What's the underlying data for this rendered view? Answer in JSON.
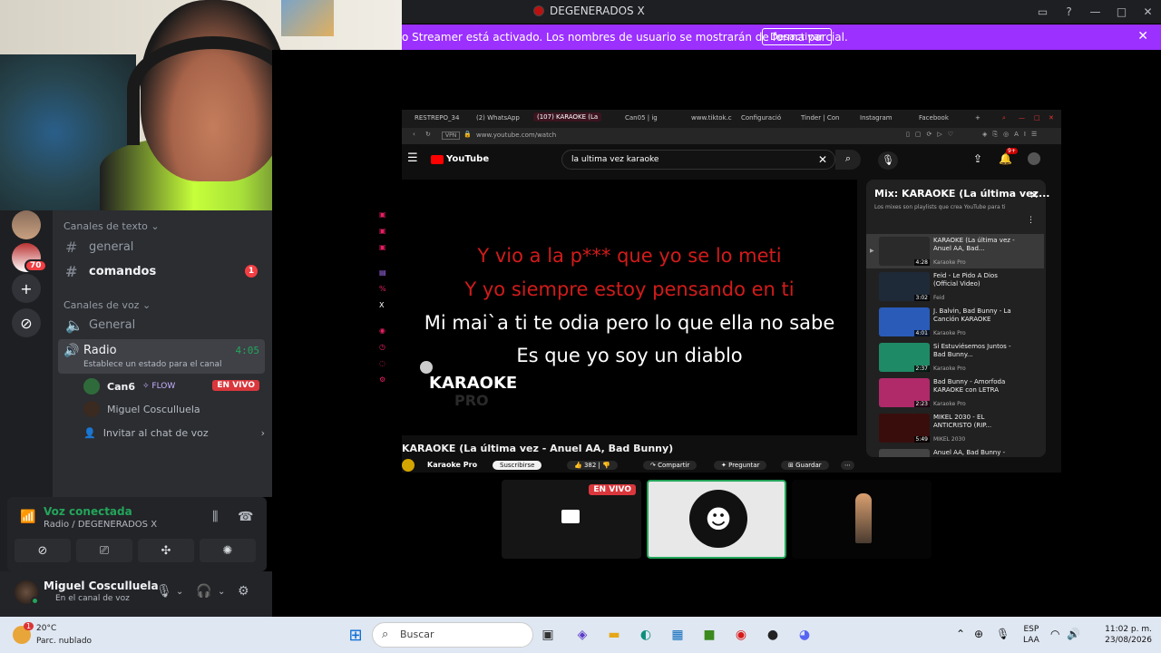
{
  "titlebar": {
    "title": "DEGENERADOS X"
  },
  "banner": {
    "message": "o Streamer está activado. Los nombres de usuario se mostrarán de forma parcial.",
    "button": "Desactivar"
  },
  "servers": {
    "badge": "70"
  },
  "channels": {
    "text_category": "Canales de texto",
    "text_channels": [
      {
        "name": "general"
      },
      {
        "name": "comandos",
        "unread": "1"
      }
    ],
    "voice_category": "Canales de voz",
    "voice_channels": [
      {
        "name": "General"
      }
    ],
    "radio": {
      "name": "Radio",
      "time": "4:05",
      "status": "Establece un estado para el canal"
    },
    "members": [
      {
        "name": "Can6",
        "activity": "FLOW",
        "live": "EN VIVO"
      },
      {
        "name": "Miguel Cosculluela"
      }
    ],
    "invite": "Invitar al chat de voz"
  },
  "voice": {
    "status": "Voz conectada",
    "location": "Radio / DEGENERADOS X"
  },
  "user": {
    "name": "Miguel Cosculluela",
    "status": "En el canal de voz"
  },
  "browser": {
    "tabs": [
      "RESTREPO_34",
      "(2) WhatsApp",
      "(107) KARAOKE (La",
      "Can05 | ig",
      "www.tiktok.c",
      "Configuració",
      "Tinder | Con",
      "Instagram",
      "Facebook"
    ],
    "url": "www.youtube.com/watch",
    "yt_logo": "YouTube",
    "search": "la ultima vez karaoke",
    "lyrics": {
      "line1": "Y vio a la p*** que yo se lo meti",
      "line2": "Y yo siempre estoy pensando en ti",
      "line3": "Mi mai`a ti te odia pero lo que ella no sabe",
      "line4": "Es que yo soy un diablo"
    },
    "watermark": "KARAOKE",
    "watermark2": "PRO",
    "video_title": "KARAOKE (La última vez - Anuel AA, Bad Bunny)",
    "channel": "Karaoke Pro",
    "subscribe": "Suscribirse",
    "likes": "382",
    "share": "Compartir",
    "ask": "Preguntar",
    "save": "Guardar",
    "mix": {
      "title": "Mix: KARAOKE (La última vez...",
      "subtitle": "Los mixes son playlists que crea YouTube para ti",
      "items": [
        {
          "title": "KARAOKE (La última vez - Anuel AA, Bad...",
          "channel": "Karaoke Pro",
          "duration": "4:28"
        },
        {
          "title": "Feid - Le Pido A Dios (Official Video)",
          "channel": "Feid",
          "duration": "3:02"
        },
        {
          "title": "J. Balvin, Bad Bunny - La Canción KARAOKE",
          "channel": "Karaoke Pro",
          "duration": "4:01"
        },
        {
          "title": "Si Estuviésemos Juntos - Bad Bunny...",
          "channel": "Karaoke Pro",
          "duration": "2:37"
        },
        {
          "title": "Bad Bunny - Amorfoda KARAOKE con LETRA",
          "channel": "Karaoke Pro",
          "duration": "2:23"
        },
        {
          "title": "MIKEL 2030 - EL ANTICRISTO (RIP...",
          "channel": "MIKEL 2030",
          "duration": "5:49"
        },
        {
          "title": "Anuel AA, Bad Bunny -",
          "channel": "",
          "duration": ""
        }
      ]
    }
  },
  "thumbs": {
    "live": "EN VIVO"
  },
  "taskbar": {
    "temp": "20°C",
    "condition": "Parc. nublado",
    "weather_badge": "1",
    "search": "Buscar",
    "lang1": "ESP",
    "lang2": "LAA",
    "time": "11:02 p. m.",
    "date": "23/08/2026"
  }
}
